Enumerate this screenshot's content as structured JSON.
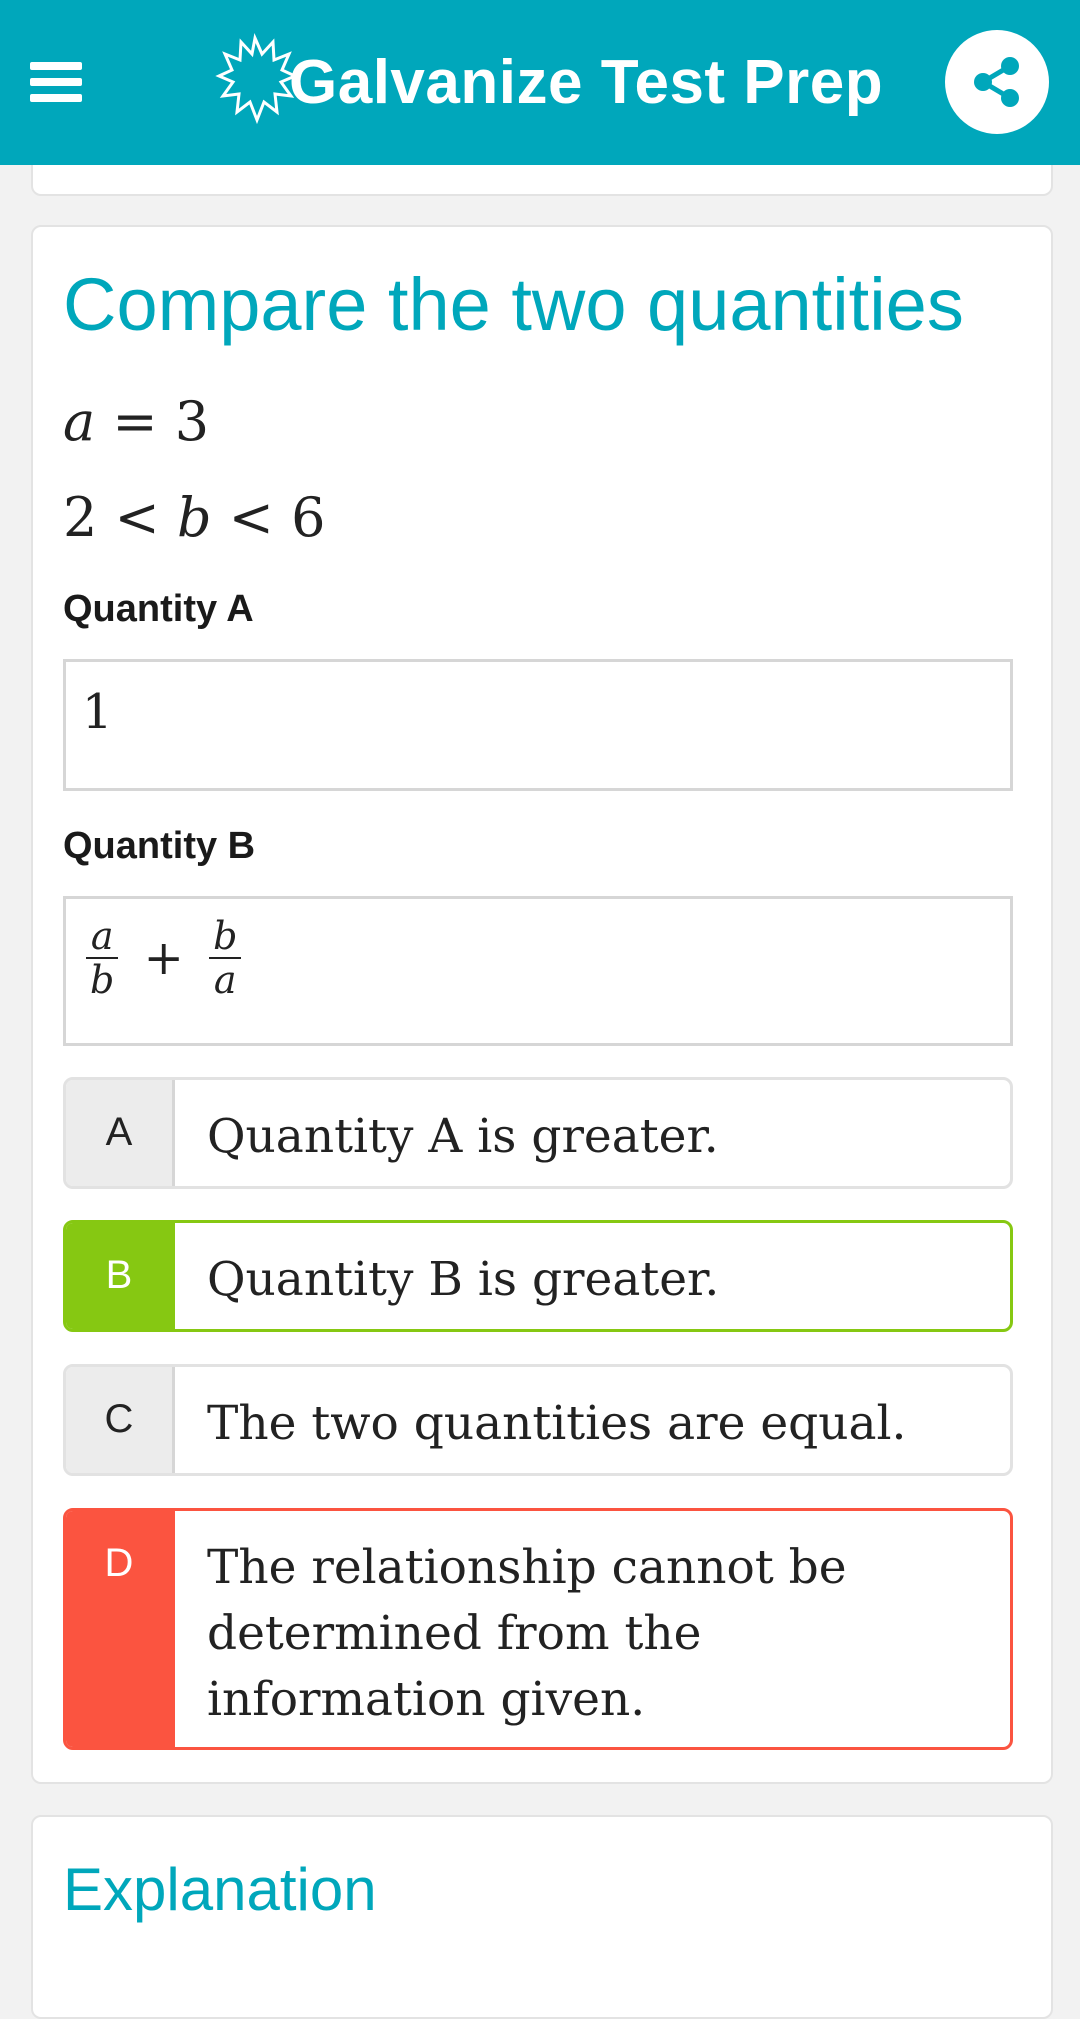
{
  "header": {
    "brand_name": "Galvanize Test Prep",
    "menu_icon": "hamburger-menu-icon",
    "share_icon": "share-icon",
    "background_color": "#00a7bb"
  },
  "question": {
    "title": "Compare the two quantities",
    "given": [
      {
        "var": "a",
        "expr": " = 3"
      },
      {
        "prefix": "2 < ",
        "var": "b",
        "suffix": " < 6"
      }
    ],
    "quantity_a": {
      "label": "Quantity A",
      "value": "1"
    },
    "quantity_b": {
      "label": "Quantity B",
      "frac1": {
        "num": "a",
        "den": "b"
      },
      "operator": "+",
      "frac2": {
        "num": "b",
        "den": "a"
      }
    }
  },
  "options": [
    {
      "letter": "A",
      "text": "Quantity A is greater.",
      "state": "default"
    },
    {
      "letter": "B",
      "text": "Quantity B is greater.",
      "state": "correct"
    },
    {
      "letter": "C",
      "text": "The two quantities are equal.",
      "state": "default"
    },
    {
      "letter": "D",
      "text": "The relationship cannot be determined from the information given.",
      "state": "incorrect"
    }
  ],
  "explanation": {
    "title": "Explanation"
  },
  "colors": {
    "accent": "#00a7bb",
    "correct": "#86c812",
    "incorrect": "#fb5440"
  }
}
